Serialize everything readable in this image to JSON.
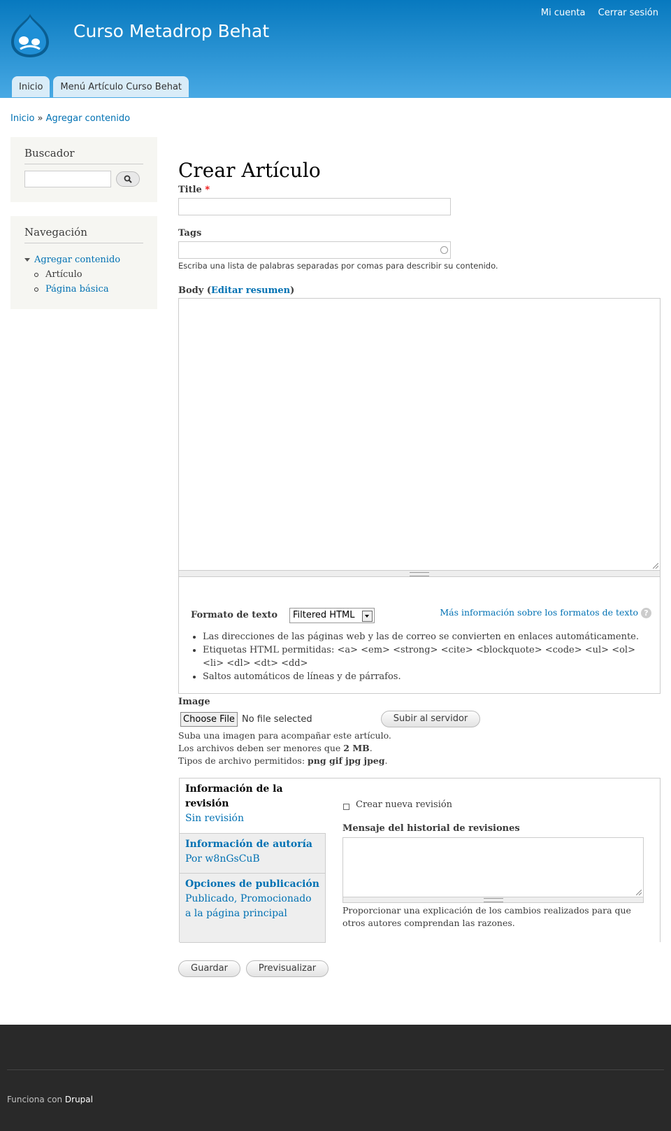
{
  "site": {
    "name": "Curso Metadrop Behat",
    "secondary_menu": [
      "Mi cuenta",
      "Cerrar sesión"
    ],
    "main_menu": [
      "Inicio",
      "Menú Artículo Curso Behat"
    ]
  },
  "breadcrumb": {
    "home": "Inicio",
    "separator": "»",
    "current": "Agregar contenido"
  },
  "sidebar": {
    "search_title": "Buscador",
    "nav_title": "Navegación",
    "nav_items": [
      {
        "label": "Agregar contenido"
      },
      {
        "label": "Artículo"
      },
      {
        "label": "Página básica"
      }
    ]
  },
  "form": {
    "page_title": "Crear Artículo",
    "title_label": "Title",
    "required_marker": "*",
    "tags_label": "Tags",
    "tags_description": "Escriba una lista de palabras separadas por comas para describir su contenido.",
    "body_label": "Body",
    "body_open_paren": "(",
    "body_summary_link": "Editar resumen",
    "body_close_paren": ")",
    "text_format_label": "Formato de texto",
    "text_format_value": "Filtered HTML",
    "text_format_help": "Más información sobre los formatos de texto",
    "text_format_tips": [
      "Las direcciones de las páginas web y las de correo se convierten en enlaces automáticamente.",
      "Etiquetas HTML permitidas: <a> <em> <strong> <cite> <blockquote> <code> <ul> <ol> <li> <dl> <dt> <dd>",
      "Saltos automáticos de líneas y de párrafos."
    ],
    "image_label": "Image",
    "choose_file": "Choose File",
    "no_file": "No file selected",
    "upload_button": "Subir al servidor",
    "image_desc_1": "Suba una imagen para acompañar este artículo.",
    "image_desc_2_prefix": "Los archivos deben ser menores que",
    "image_desc_2_size": "2 MB",
    "image_desc_3_prefix": "Tipos de archivo permitidos:",
    "image_desc_3_types": "png gif jpg jpeg",
    "period": ".",
    "vertical_tabs": [
      {
        "title": "Información de la revisión",
        "summary": "Sin revisión"
      },
      {
        "title": "Información de autoría",
        "summary": "Por w8nGsCuB"
      },
      {
        "title": "Opciones de publicación",
        "summary": "Publicado, Promocionado a la página principal"
      }
    ],
    "new_revision_label": "Crear nueva revisión",
    "log_label": "Mensaje del historial de revisiones",
    "log_description": "Proporcionar una explicación de los cambios realizados para que otros autores comprendan las razones.",
    "save_button": "Guardar",
    "preview_button": "Previsualizar"
  },
  "footer": {
    "powered_by": "Funciona con",
    "drupal": "Drupal"
  },
  "colors": {
    "header_top": "#0779bf",
    "header_bottom": "#48a9e4",
    "link": "#0071b3",
    "footer": "#292929",
    "required": "#e00"
  }
}
